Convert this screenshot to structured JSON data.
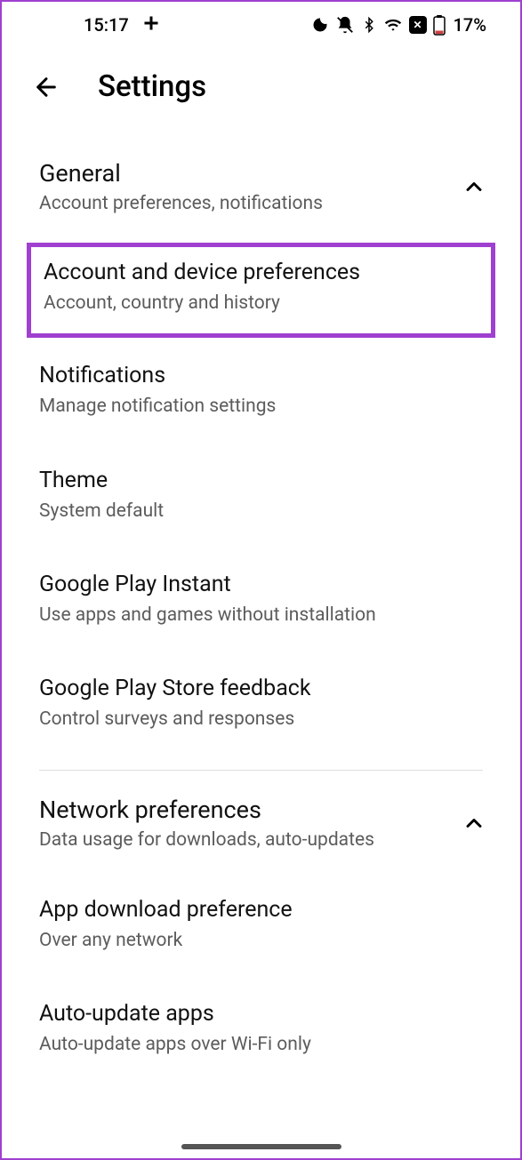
{
  "status": {
    "time": "15:17",
    "battery_text": "17%"
  },
  "header": {
    "title": "Settings"
  },
  "sections": {
    "general": {
      "title": "General",
      "subtitle": "Account preferences, notifications",
      "items": {
        "account_device": {
          "title": "Account and device preferences",
          "subtitle": "Account, country and history"
        },
        "notifications": {
          "title": "Notifications",
          "subtitle": "Manage notification settings"
        },
        "theme": {
          "title": "Theme",
          "subtitle": "System default"
        },
        "play_instant": {
          "title": "Google Play Instant",
          "subtitle": "Use apps and games without installation"
        },
        "feedback": {
          "title": "Google Play Store feedback",
          "subtitle": "Control surveys and responses"
        }
      }
    },
    "network": {
      "title": "Network preferences",
      "subtitle": "Data usage for downloads, auto-updates",
      "items": {
        "download_pref": {
          "title": "App download preference",
          "subtitle": "Over any network"
        },
        "auto_update": {
          "title": "Auto-update apps",
          "subtitle": "Auto-update apps over Wi-Fi only"
        }
      }
    }
  }
}
